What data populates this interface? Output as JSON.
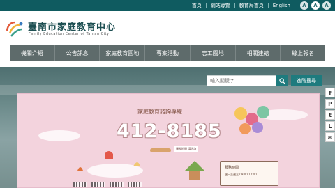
{
  "util_bar": {
    "links": [
      "首頁",
      "網站導覽",
      "教育局首頁",
      "English"
    ],
    "font_sizes": [
      "A",
      "A",
      "A"
    ]
  },
  "header": {
    "title": "臺南市家庭教育中心",
    "subtitle": "Family  Education  Center  of  Tainan  City"
  },
  "nav": {
    "items": [
      "機關介紹",
      "公告訊息",
      "家庭教育園地",
      "專案活動",
      "志工園地",
      "相關連結",
      "線上報名"
    ]
  },
  "search": {
    "placeholder": "輸入關鍵字",
    "advanced_label": "進階搜尋"
  },
  "banner": {
    "title": "家庭教育諮詢專線",
    "hotline": "412-8185",
    "hours_note": "服務時間 請洽詢",
    "board_title": "服務時間",
    "board_line": "週一至週五 09:00-17:00"
  },
  "social": {
    "icons": [
      "f",
      "P",
      "t",
      "L",
      "✉"
    ]
  },
  "colors": {
    "util_bar": "#0f5b60",
    "nav": "#5e6b6b",
    "accent": "#1e7b7e",
    "banner_bg": "#f3d3dd"
  }
}
